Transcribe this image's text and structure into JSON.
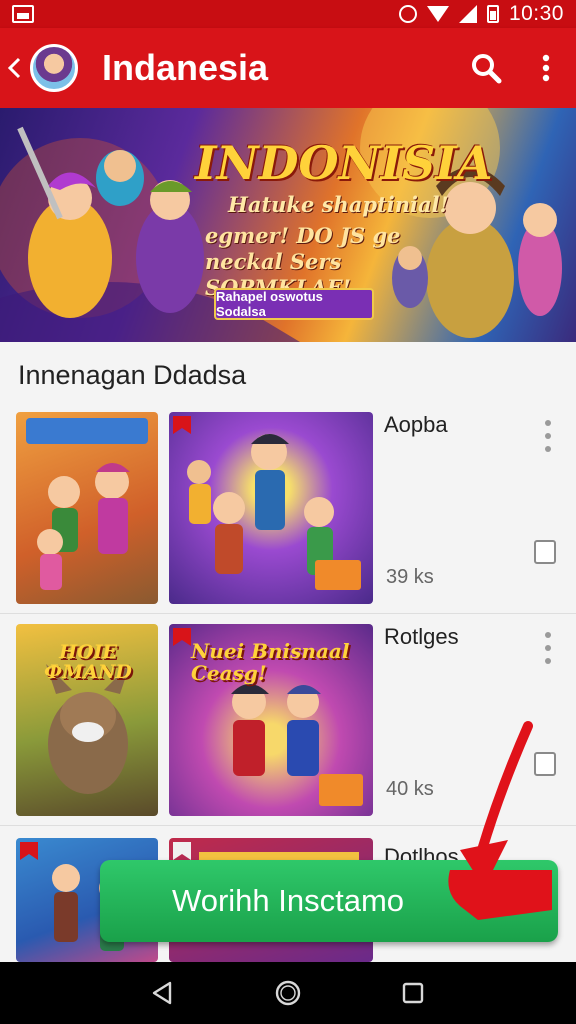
{
  "status_bar": {
    "time": "10:30"
  },
  "app_bar": {
    "title": "Indanesia"
  },
  "banner": {
    "title": "INDONISIA",
    "line1": "Hatuke shaptinial!",
    "line2": "egmer! DO JS ge neckal Sers SOPMKLAF!",
    "button": "Rahapel oswotus Sodalsa"
  },
  "section": {
    "title": "Innenagan Ddadsa"
  },
  "items": [
    {
      "title": "Aopba",
      "size": "39 ks"
    },
    {
      "title": "Rotlges",
      "size": "40 ks",
      "thumb_text_left": "HOIE ФMAND",
      "thumb_text_right": "Nuei Bnisnaal Ceasg!"
    },
    {
      "title": "Dotlhos"
    }
  ],
  "install_button": {
    "label": "Worihh Insctamo"
  },
  "colors": {
    "app_bar": "#d81419",
    "status_bar": "#c80d12",
    "install": "#22b457",
    "arrow": "#e0121a"
  }
}
